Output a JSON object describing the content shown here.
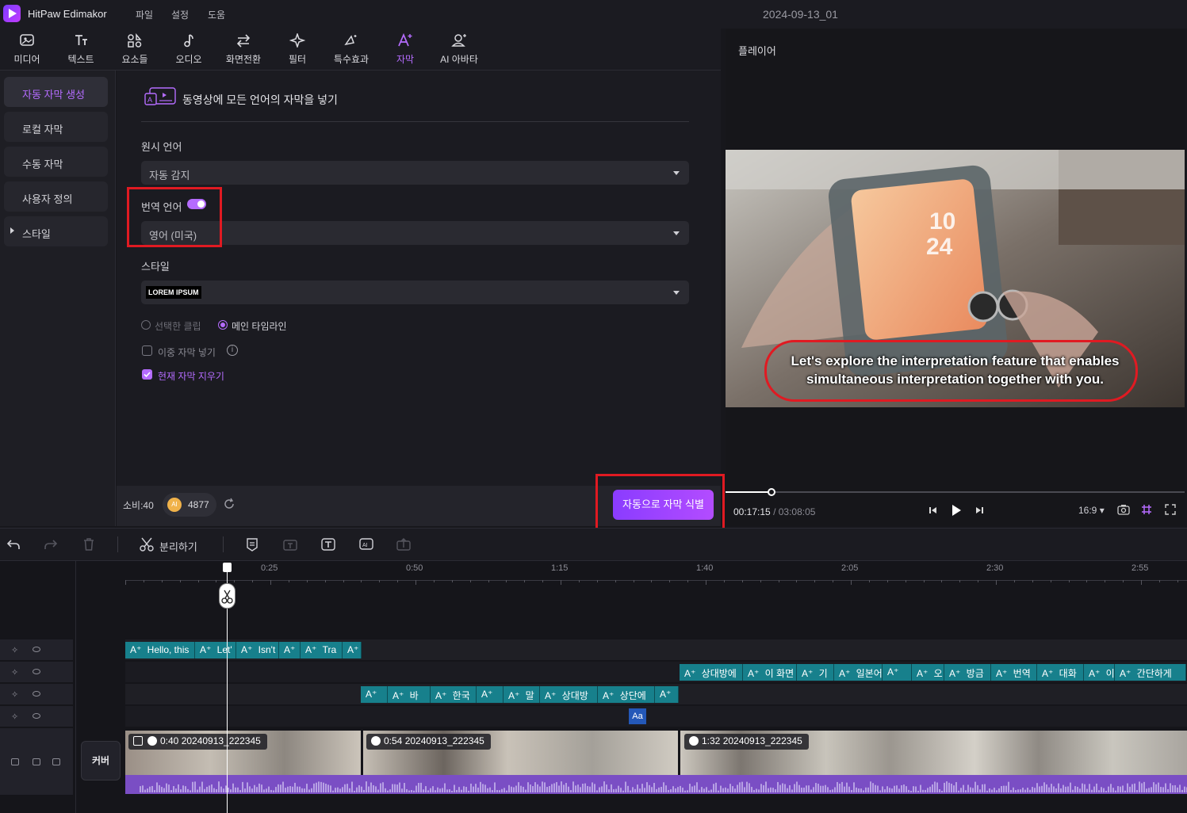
{
  "app": {
    "name": "HitPaw Edimakor",
    "menus": [
      "파일",
      "설정",
      "도움"
    ],
    "doc_title": "2024-09-13_01"
  },
  "toolbar": [
    {
      "label": "미디어",
      "icon": "media-icon"
    },
    {
      "label": "텍스트",
      "icon": "text-icon"
    },
    {
      "label": "요소들",
      "icon": "elements-icon"
    },
    {
      "label": "오디오",
      "icon": "audio-icon"
    },
    {
      "label": "화면전환",
      "icon": "transition-icon"
    },
    {
      "label": "필터",
      "icon": "filter-icon"
    },
    {
      "label": "특수효과",
      "icon": "effects-icon"
    },
    {
      "label": "자막",
      "icon": "subtitle-icon",
      "active": true
    },
    {
      "label": "AI 아바타",
      "icon": "avatar-icon"
    }
  ],
  "leftnav": [
    "자동 자막 생성",
    "로컬 자막",
    "수동 자막",
    "사용자 정의",
    "스타일"
  ],
  "panel": {
    "header": "동영상에 모든 언어의 자막을 넣기",
    "source_lang_label": "원시 언어",
    "source_lang_value": "자동 감지",
    "translate_label": "번역 언어",
    "translate_value": "영어 (미국)",
    "style_label": "스타일",
    "style_value": "LOREM IPSUM",
    "radio_selected_clip": "선택한 클립",
    "radio_main_timeline": "메인 타임라인",
    "dual_subtitle": "이중 자막 넣기",
    "clear_current": "현재 자막 지우기",
    "cost_label": "소비:40",
    "credits": "4877",
    "ai_badge": "AI",
    "generate_button": "자동으로 자막 식별"
  },
  "player": {
    "title": "플레이어",
    "subtitle_line1": "Let's explore the interpretation feature that enables",
    "subtitle_line2": "simultaneous interpretation together with you.",
    "phone_time_h": "10",
    "phone_time_m": "24",
    "current_time": "00:17:15",
    "separator": "/",
    "total_time": "03:08:05",
    "aspect": "16:9",
    "progress": 0.1
  },
  "timeline_toolbar": {
    "split_label": "분리하기"
  },
  "timeline": {
    "ticks": [
      "0:25",
      "0:50",
      "1:15",
      "1:40",
      "2:05",
      "2:30",
      "2:55"
    ],
    "cover_label": "커버",
    "track1": [
      "Hello, this",
      "Let'",
      "Isn't",
      "",
      "Tra",
      ""
    ],
    "track2": [
      "상대방에",
      "이 화면",
      "기",
      "일본어",
      "",
      "오",
      "방금",
      "번역",
      "대화",
      "이",
      "간단하게"
    ],
    "track3": [
      "",
      "바",
      "한국",
      "",
      "말",
      "상대방",
      "상단에",
      ""
    ],
    "clips": [
      {
        "label": "0:40 20240913_222345"
      },
      {
        "label": "0:54 20240913_222345"
      },
      {
        "label": "1:32 20240913_222345"
      }
    ]
  }
}
